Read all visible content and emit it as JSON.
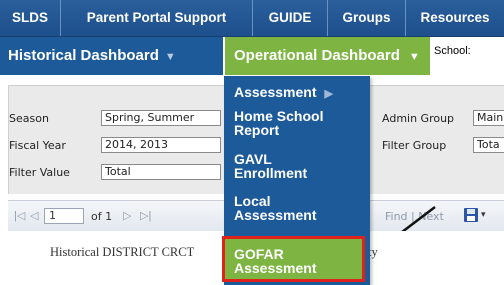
{
  "topnav": {
    "items": [
      "SLDS",
      "Parent Portal Support",
      "GUIDE",
      "Groups",
      "Resources"
    ]
  },
  "subnav": {
    "historical_label": "Historical Dashboard",
    "operational_label": "Operational Dashboard",
    "caret": "▼",
    "school_label": "School:"
  },
  "filters": {
    "season_label": "Season",
    "season_value": "Spring, Summer",
    "fiscal_year_label": "Fiscal Year",
    "fiscal_year_value": "2014, 2013",
    "filter_value_label": "Filter Value",
    "filter_value_value": "Total",
    "admin_group_label": "Admin Group",
    "admin_group_value": "Main",
    "filter_group_label": "Filter Group",
    "filter_group_value": "Tota"
  },
  "toolbar": {
    "first": "|◁",
    "prev": "◁",
    "page_value": "1",
    "of_label": "of 1",
    "next": "▷",
    "last": "▷|",
    "find_label": "Find | Next"
  },
  "report": {
    "title_left": "Historical DISTRICT CRCT",
    "title_right": "County"
  },
  "menu": {
    "items": [
      {
        "line1": "Assessment",
        "line2": "",
        "has_submenu": true
      },
      {
        "line1": "Home School",
        "line2": "Report",
        "has_submenu": false
      },
      {
        "line1": "GAVL",
        "line2": "Enrollment",
        "has_submenu": false
      },
      {
        "line1": "Local",
        "line2": "Assessment",
        "has_submenu": false
      },
      {
        "line1": "GOFAR",
        "line2": "Assessment",
        "has_submenu": false
      }
    ],
    "submenu_arrow": "▶",
    "highlight_item": "GOFAR Assessment"
  },
  "colors": {
    "nav_blue": "#1d5a9a",
    "operational_green": "#7db442",
    "highlight_border": "#e0231a"
  }
}
